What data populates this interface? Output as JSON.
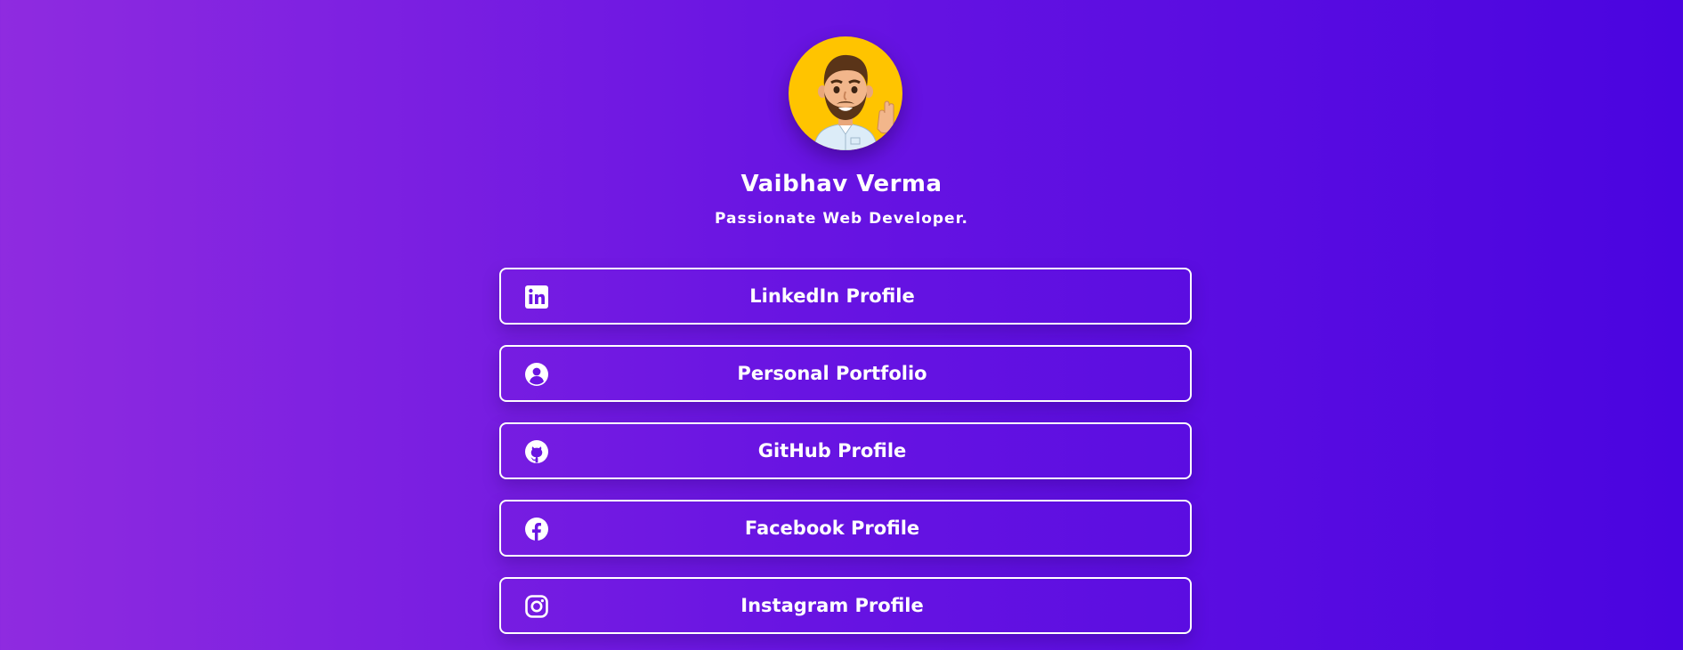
{
  "profile": {
    "name": "Vaibhav Verma",
    "tagline": "Passionate Web Developer.",
    "avatar_icon": "memoji-avatar-waving",
    "avatar_background": "#ffc400"
  },
  "links": [
    {
      "label": "LinkedIn Profile",
      "icon": "linkedin-icon"
    },
    {
      "label": "Personal Portfolio",
      "icon": "user-circle-icon"
    },
    {
      "label": "GitHub Profile",
      "icon": "github-icon"
    },
    {
      "label": "Facebook Profile",
      "icon": "facebook-icon"
    },
    {
      "label": "Instagram Profile",
      "icon": "instagram-icon"
    }
  ],
  "colors": {
    "gradient_start": "#8f2be0",
    "gradient_end": "#4a04e0",
    "text": "#ffffff"
  }
}
